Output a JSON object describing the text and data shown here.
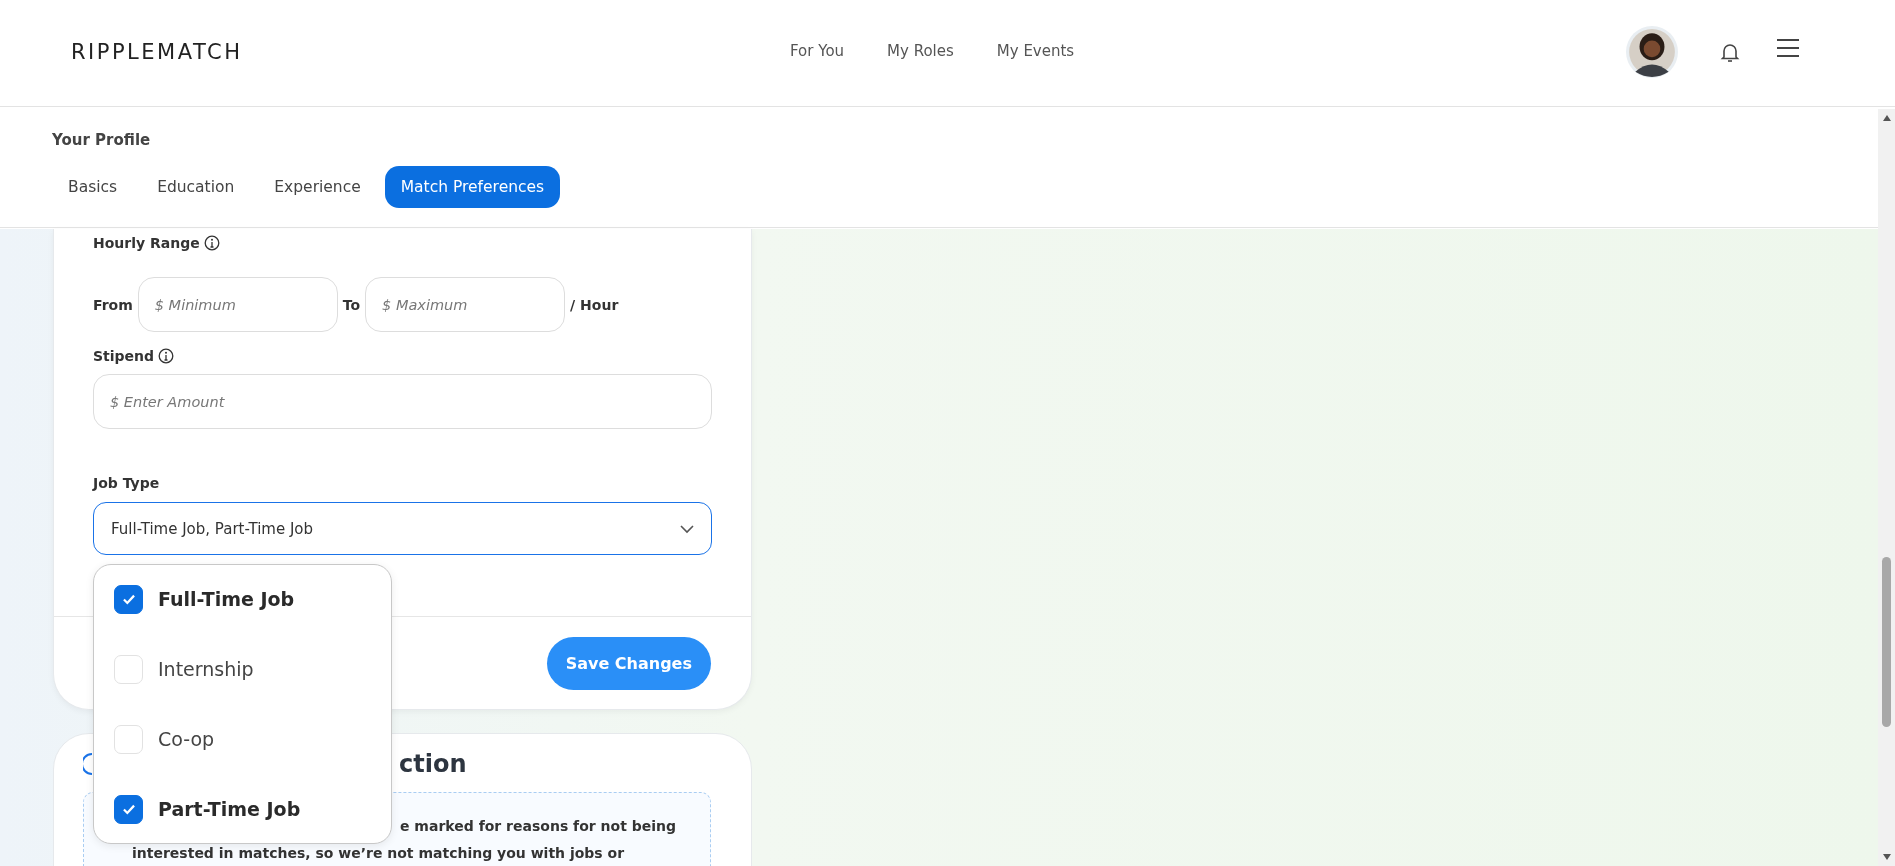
{
  "header": {
    "logo": "RIPPLEMATCH",
    "nav": [
      {
        "label": "For You"
      },
      {
        "label": "My Roles"
      },
      {
        "label": "My Events"
      }
    ]
  },
  "profile": {
    "title": "Your Profile",
    "tabs": [
      {
        "label": "Basics",
        "selected": false
      },
      {
        "label": "Education",
        "selected": false
      },
      {
        "label": "Experience",
        "selected": false
      },
      {
        "label": "Match Preferences",
        "selected": true
      }
    ]
  },
  "form": {
    "hourly_range": {
      "label": "Hourly Range",
      "from_label": "From",
      "min_placeholder": "$ Minimum",
      "to_label": "To",
      "max_placeholder": "$ Maximum",
      "unit": "/ Hour"
    },
    "stipend": {
      "label": "Stipend",
      "placeholder": "$ Enter Amount"
    },
    "job_type": {
      "label": "Job Type",
      "value": "Full-Time Job, Part-Time Job",
      "expanded": true,
      "options": [
        {
          "label": "Full-Time Job",
          "checked": true
        },
        {
          "label": "Internship",
          "checked": false
        },
        {
          "label": "Co-op",
          "checked": false
        },
        {
          "label": "Part-Time Job",
          "checked": true
        }
      ]
    },
    "save_button": "Save Changes"
  },
  "second_card": {
    "heading": "ction",
    "notice_lines": [
      "e marked for reasons for not being",
      "interested in matches, so we’re not matching you with jobs or"
    ]
  }
}
